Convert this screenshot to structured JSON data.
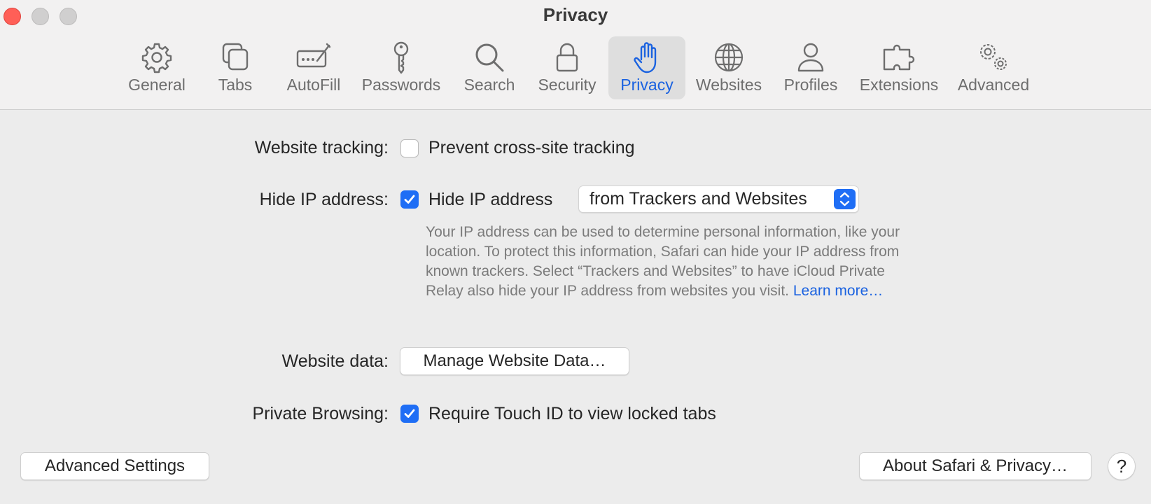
{
  "window": {
    "title": "Privacy"
  },
  "toolbar": {
    "tabs": [
      {
        "label": "General",
        "icon": "gear-icon"
      },
      {
        "label": "Tabs",
        "icon": "tabs-icon"
      },
      {
        "label": "AutoFill",
        "icon": "autofill-icon"
      },
      {
        "label": "Passwords",
        "icon": "key-icon"
      },
      {
        "label": "Search",
        "icon": "search-icon"
      },
      {
        "label": "Security",
        "icon": "lock-icon"
      },
      {
        "label": "Privacy",
        "icon": "hand-icon",
        "selected": true
      },
      {
        "label": "Websites",
        "icon": "globe-icon"
      },
      {
        "label": "Profiles",
        "icon": "person-icon"
      },
      {
        "label": "Extensions",
        "icon": "puzzle-icon"
      },
      {
        "label": "Advanced",
        "icon": "gears-icon"
      }
    ]
  },
  "privacy": {
    "tracking": {
      "label": "Website tracking:",
      "option": "Prevent cross-site tracking",
      "checked": false
    },
    "hide_ip": {
      "label": "Hide IP address:",
      "option": "Hide IP address",
      "checked": true,
      "select_value": "from Trackers and Websites",
      "description": "Your IP address can be used to determine personal information, like your location. To protect this information, Safari can hide your IP address from known trackers. Select “Trackers and Websites” to have iCloud Private Relay also hide your IP address from websites you visit.",
      "learn_more": "Learn more…"
    },
    "website_data": {
      "label": "Website data:",
      "button": "Manage Website Data…"
    },
    "private_browsing": {
      "label": "Private Browsing:",
      "option": "Require Touch ID to view locked tabs",
      "checked": true
    }
  },
  "footer": {
    "advanced_settings": "Advanced Settings",
    "about": "About Safari & Privacy…",
    "help": "?"
  },
  "colors": {
    "accent": "#1f6ef5",
    "selected_tab_text": "#1a62e0",
    "close_button": "#ff5f57"
  }
}
